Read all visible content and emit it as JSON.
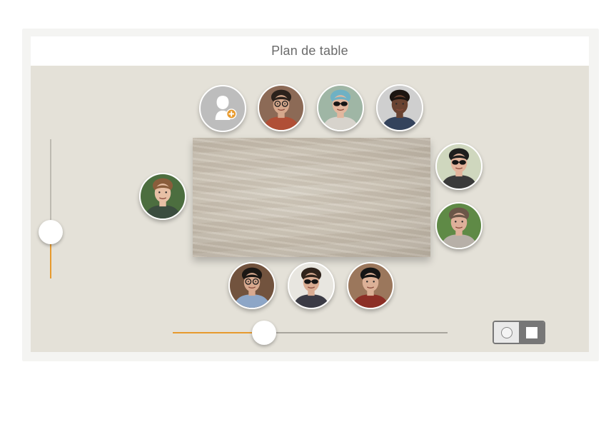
{
  "header": {
    "title": "Plan de table"
  },
  "colors": {
    "accent": "#e79a2e",
    "canvas": "#e4e1d8",
    "toggle_active": "#777777"
  },
  "add_guest": {
    "icon": "person-add-icon"
  },
  "guests": [
    {
      "position": "top-2",
      "hair": "#2b221c",
      "skin": "#d6a88c",
      "shirt": "#b04f36",
      "bg": "#8c6a56",
      "glasses": "clear"
    },
    {
      "position": "top-3",
      "hair": "#6fb1c4",
      "skin": "#e2b79e",
      "shirt": "#d7d3cc",
      "bg": "#9fb6a5",
      "glasses": "sunglasses"
    },
    {
      "position": "top-4",
      "hair": "#1c1511",
      "skin": "#6a4331",
      "shirt": "#34435c",
      "bg": "#cfcfcf",
      "glasses": "none"
    },
    {
      "position": "right-1",
      "hair": "#1e1e1e",
      "skin": "#e3b49c",
      "shirt": "#3a3a3a",
      "bg": "#cfd7be",
      "glasses": "sunglasses"
    },
    {
      "position": "right-2",
      "hair": "#6b5648",
      "skin": "#deb09a",
      "shirt": "#b7b0a8",
      "bg": "#5f8a46",
      "glasses": "none"
    },
    {
      "position": "left-1",
      "hair": "#8a5d3b",
      "skin": "#e8c0a5",
      "shirt": "#3b4d3f",
      "bg": "#4c6e3f",
      "glasses": "none"
    },
    {
      "position": "bottom-1",
      "hair": "#1b1714",
      "skin": "#d8a98f",
      "shirt": "#8da6c7",
      "bg": "#72533e",
      "glasses": "clear"
    },
    {
      "position": "bottom-2",
      "hair": "#2f231b",
      "skin": "#d9ac92",
      "shirt": "#3b3b45",
      "bg": "#e8e6e0",
      "glasses": "sunglasses"
    },
    {
      "position": "bottom-3",
      "hair": "#141414",
      "skin": "#dcb197",
      "shirt": "#8c2f26",
      "bg": "#9b775c",
      "glasses": "none"
    }
  ],
  "zoom_slider": {
    "value": 0.33
  },
  "spacing_slider": {
    "value": 0.33
  },
  "table_shape_toggle": {
    "options": [
      "round-table-icon",
      "rectangle-table-icon"
    ],
    "selected": "rectangle-table-icon"
  }
}
